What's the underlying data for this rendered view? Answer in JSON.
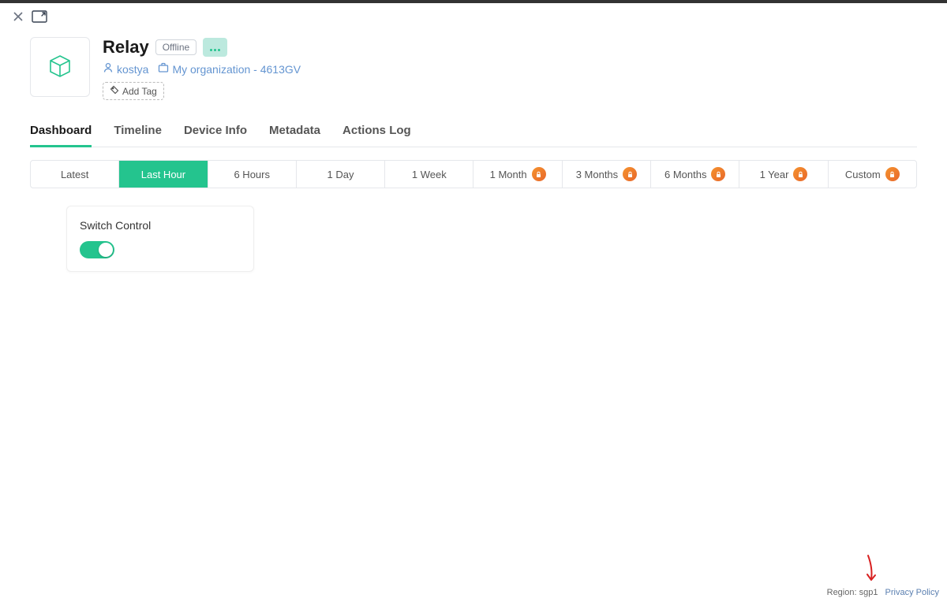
{
  "header": {
    "title": "Relay",
    "status": "Offline",
    "user": "kostya",
    "organization": "My organization - 4613GV",
    "add_tag_label": "Add Tag"
  },
  "tabs": [
    {
      "label": "Dashboard",
      "active": true
    },
    {
      "label": "Timeline",
      "active": false
    },
    {
      "label": "Device Info",
      "active": false
    },
    {
      "label": "Metadata",
      "active": false
    },
    {
      "label": "Actions Log",
      "active": false
    }
  ],
  "time_ranges": [
    {
      "label": "Latest",
      "locked": false,
      "active": false
    },
    {
      "label": "Last Hour",
      "locked": false,
      "active": true
    },
    {
      "label": "6 Hours",
      "locked": false,
      "active": false
    },
    {
      "label": "1 Day",
      "locked": false,
      "active": false
    },
    {
      "label": "1 Week",
      "locked": false,
      "active": false
    },
    {
      "label": "1 Month",
      "locked": true,
      "active": false
    },
    {
      "label": "3 Months",
      "locked": true,
      "active": false
    },
    {
      "label": "6 Months",
      "locked": true,
      "active": false
    },
    {
      "label": "1 Year",
      "locked": true,
      "active": false
    },
    {
      "label": "Custom",
      "locked": true,
      "active": false
    }
  ],
  "widget": {
    "title": "Switch Control",
    "enabled": true
  },
  "footer": {
    "region_label": "Region:",
    "region_value": "sgp1",
    "privacy_label": "Privacy Policy"
  },
  "icons": {
    "close": "close-icon",
    "fullscreen": "fullscreen-icon",
    "cube": "cube-icon",
    "more": "more-icon",
    "user": "user-icon",
    "briefcase": "briefcase-icon",
    "tag": "tag-icon",
    "lock": "lock-icon"
  },
  "colors": {
    "accent": "#24c48e",
    "link": "#6495d1",
    "lock_badge": "#f5932e"
  }
}
